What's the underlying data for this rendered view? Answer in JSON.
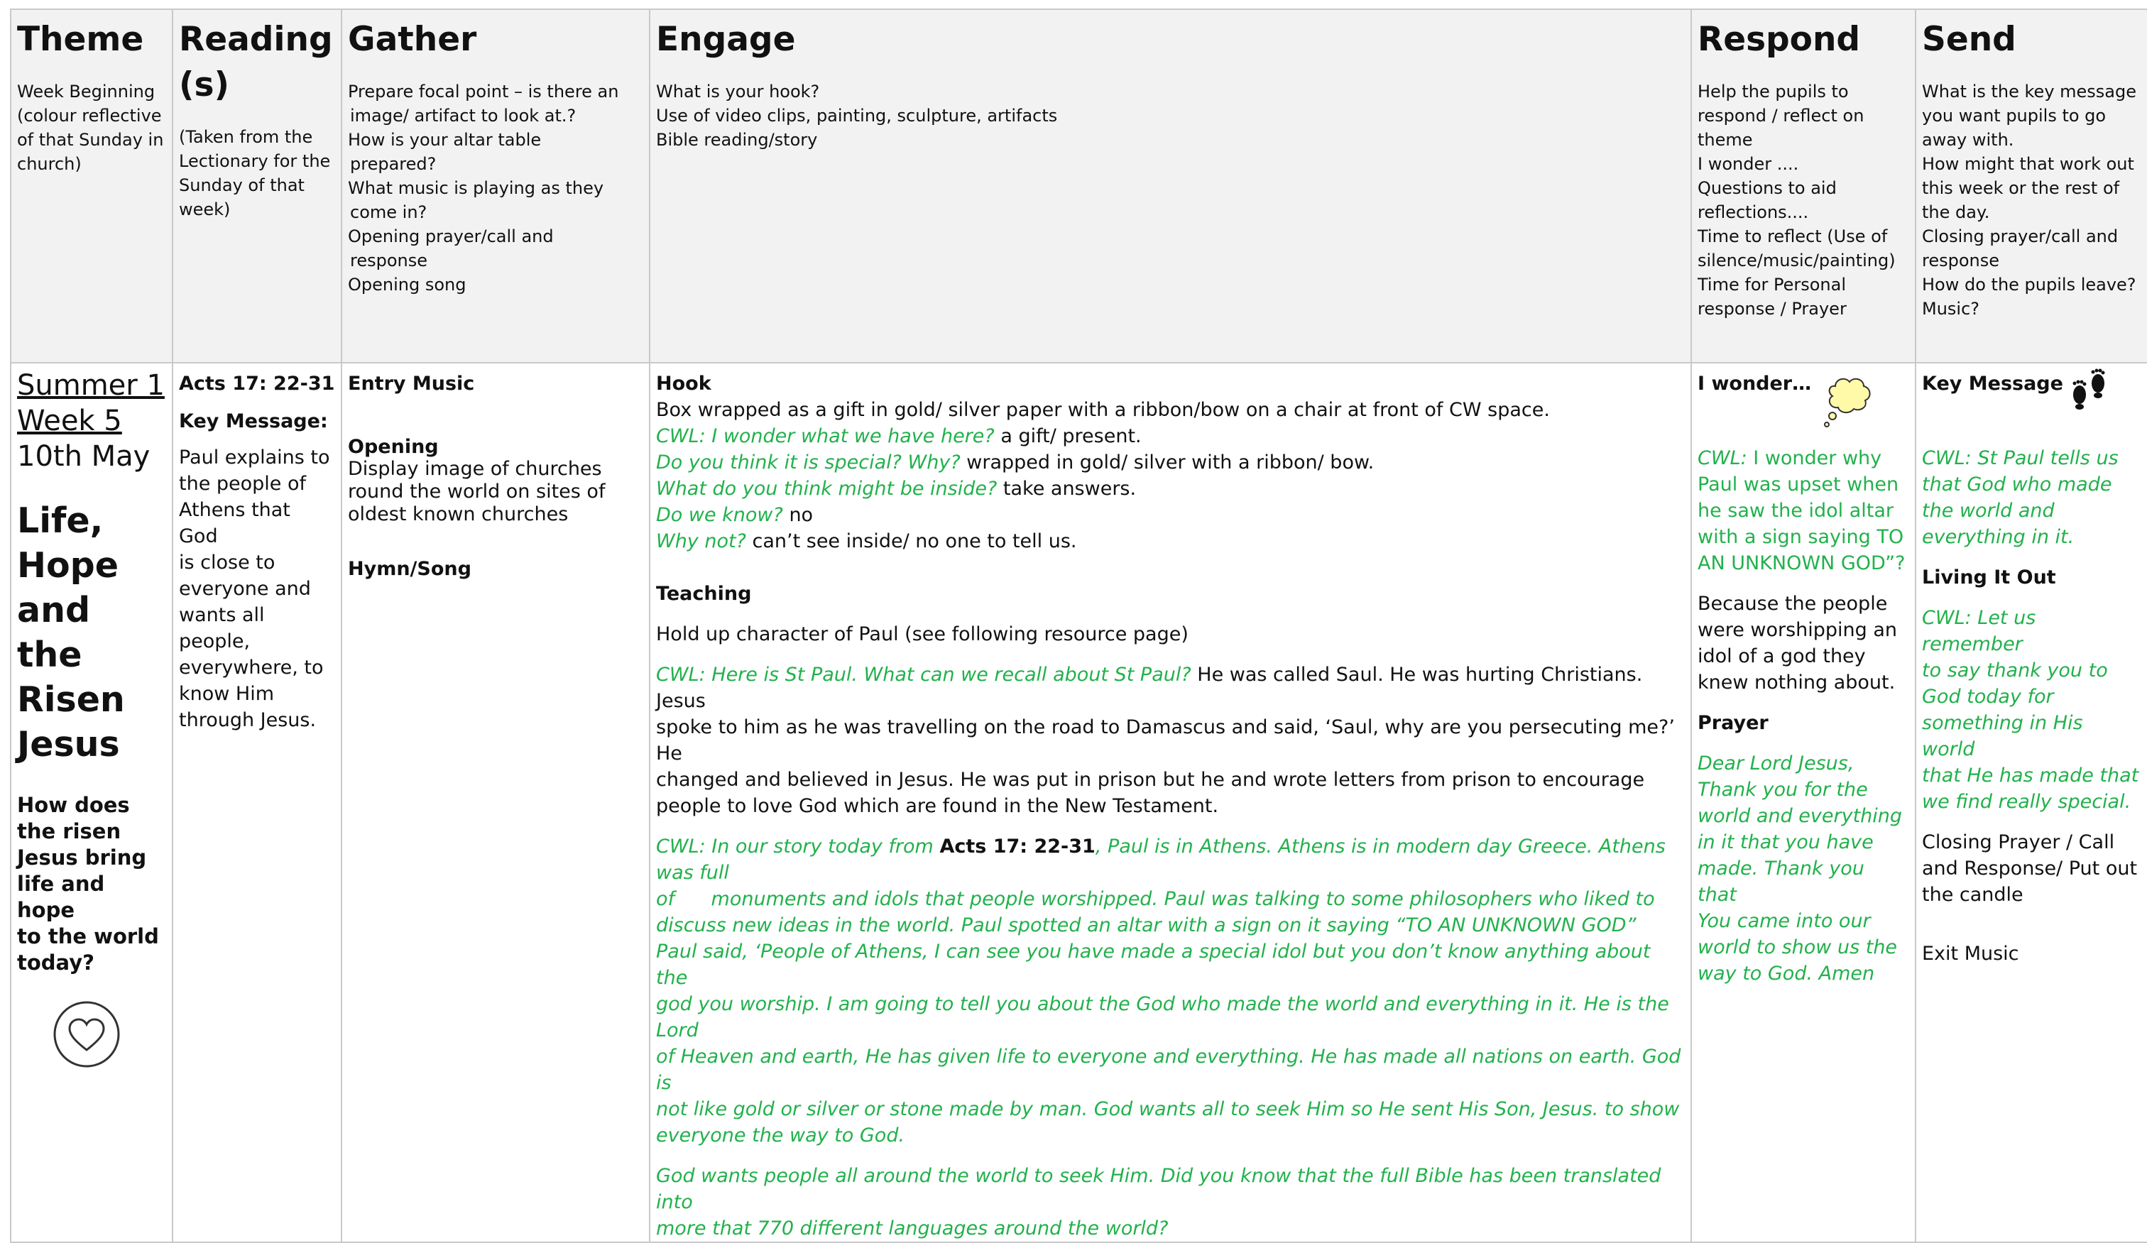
{
  "headers": {
    "theme": {
      "title": "Theme",
      "desc": [
        "Week Beginning",
        "(colour reflective",
        "of that Sunday in",
        "church)"
      ]
    },
    "reading": {
      "title1": "Reading",
      "title2": "(s)",
      "desc": [
        "(Taken from the",
        "Lectionary for the",
        "Sunday of that",
        "week)"
      ]
    },
    "gather": {
      "title": "Gather",
      "desc": [
        "Prepare focal point – is there an",
        "image/ artifact to look at.?",
        "How is your altar table",
        "prepared?",
        "What music is playing as they",
        "come in?",
        "Opening prayer/call and",
        "response",
        "Opening song"
      ]
    },
    "engage": {
      "title": "Engage",
      "desc": [
        "What is your hook?",
        "Use of video clips, painting, sculpture, artifacts",
        "Bible reading/story"
      ]
    },
    "respond": {
      "title": "Respond",
      "desc": [
        "Help the pupils to",
        "respond / reflect on",
        "theme",
        "I wonder ....",
        "Questions to aid",
        "reflections....",
        "Time to reflect (Use of",
        "silence/music/painting)",
        "Time for Personal",
        "response / Prayer"
      ]
    },
    "send": {
      "title": "Send",
      "desc": [
        "What is the key message",
        "you want   pupils to go",
        "away with.",
        "How might that work out",
        "this week or the rest of",
        "the day.",
        "Closing prayer/call and",
        "response",
        "How do the pupils leave?",
        "Music?"
      ]
    }
  },
  "theme": {
    "season1": "Summer 1",
    "season2": "Week 5",
    "date": "10th May",
    "title": [
      "Life,",
      "Hope",
      "and the",
      "Risen",
      "Jesus"
    ],
    "question": [
      "How does",
      "the risen",
      "Jesus bring",
      "life and hope",
      "to the world",
      "today?"
    ],
    "icon": "heart-in-circle-icon"
  },
  "reading": {
    "ref": "Acts 17: 22-31",
    "key_label": "Key Message:",
    "message": [
      "Paul explains to",
      "the people of",
      "Athens that God",
      "is close to",
      "everyone and",
      "wants all",
      "people,",
      "everywhere, to",
      "know Him",
      "through Jesus."
    ]
  },
  "gather": {
    "entry": "Entry Music",
    "opening": "Opening",
    "opening_desc": [
      "Display image of churches",
      "round the world on sites of",
      "oldest known churches"
    ],
    "hymn": "Hymn/Song"
  },
  "engage": {
    "hook_label": "Hook",
    "hook_intro": "Box wrapped as a gift in gold/ silver paper with a ribbon/bow on a chair at front of CW space.",
    "qa": [
      {
        "q": "CWL: I wonder what we have here?",
        "a": " a gift/ present."
      },
      {
        "q": "Do you think it is special? Why?",
        "a": " wrapped in gold/ silver with a ribbon/ bow."
      },
      {
        "q": "What do you think might be inside?",
        "a": " take answers."
      },
      {
        "q": "Do we know?",
        "a": " no"
      },
      {
        "q": "Why not?",
        "a": " can’t see inside/ no one to tell us."
      }
    ],
    "teaching_label": "Teaching",
    "teaching_intro": "Hold up character of Paul (see following resource page)",
    "paul_q": "CWL: Here is St Paul. What can we recall about St Paul?",
    "paul_a": [
      " He was called Saul. He was hurting Christians. Jesus",
      "spoke to him as he was travelling on the road to Damascus and said, ‘Saul, why are you persecuting me?’ He",
      "changed and believed in Jesus. He was put in prison but he and wrote letters from prison to encourage",
      "people to love God which are found in the New Testament."
    ],
    "story_pre": "CWL: In our story today from ",
    "story_ref": "Acts 17: 22-31",
    "story_post": ", Paul is in Athens. Athens is in modern day Greece. Athens was full",
    "story_lines": [
      "of      monuments and idols that people worshipped. Paul was talking to some philosophers who liked to",
      "discuss new ideas in the world. Paul spotted an altar with a sign on it saying “TO AN UNKNOWN GOD”",
      "Paul said, ‘People of Athens, I can see you have made a special idol but you don’t know anything about the",
      "god you worship. I am going to tell you about the God who made the world and everything in it. He is the Lord",
      "of Heaven and earth, He has given life to everyone and everything. He has made all nations on earth. God is",
      "not like gold or silver or stone made by man. God wants all to seek Him so He sent His Son, Jesus. to show",
      "everyone the way to God."
    ],
    "closing_lines": [
      "God wants people all around the world to seek Him. Did you know that the full Bible has been translated into",
      "more that 770 different languages around the world?"
    ]
  },
  "respond": {
    "wonder_label": "I wonder…",
    "wonder_icon": "thought-bubble-icon",
    "wonder_pre": "CWL:",
    "wonder_lines": [
      " I wonder why",
      "Paul was upset when",
      "he saw the idol altar",
      "with a sign saying TO",
      "AN UNKNOWN GOD”?"
    ],
    "answer": [
      "Because the people",
      "were worshipping an",
      "idol of a god they",
      "knew nothing about."
    ],
    "prayer_label": "Prayer",
    "prayer": [
      "Dear Lord Jesus,",
      "Thank you for the",
      "world and everything",
      "in it that you have",
      "made. Thank you that",
      "You came into our",
      "world to show us the",
      "way to God. Amen"
    ]
  },
  "send": {
    "key_label": "Key Message",
    "key_icon": "footprints-icon",
    "key_lines": [
      "CWL: St Paul tells us",
      "that God  who made",
      "the world and",
      "everything in it."
    ],
    "living_label": "Living It Out",
    "living_lines": [
      "CWL: Let us remember",
      "to say thank you to",
      "God today for",
      "something in His world",
      "that He has made that",
      "we find really special."
    ],
    "closing": [
      "Closing Prayer / Call",
      "and Response/ Put out",
      "the candle"
    ],
    "exit": "Exit Music"
  }
}
